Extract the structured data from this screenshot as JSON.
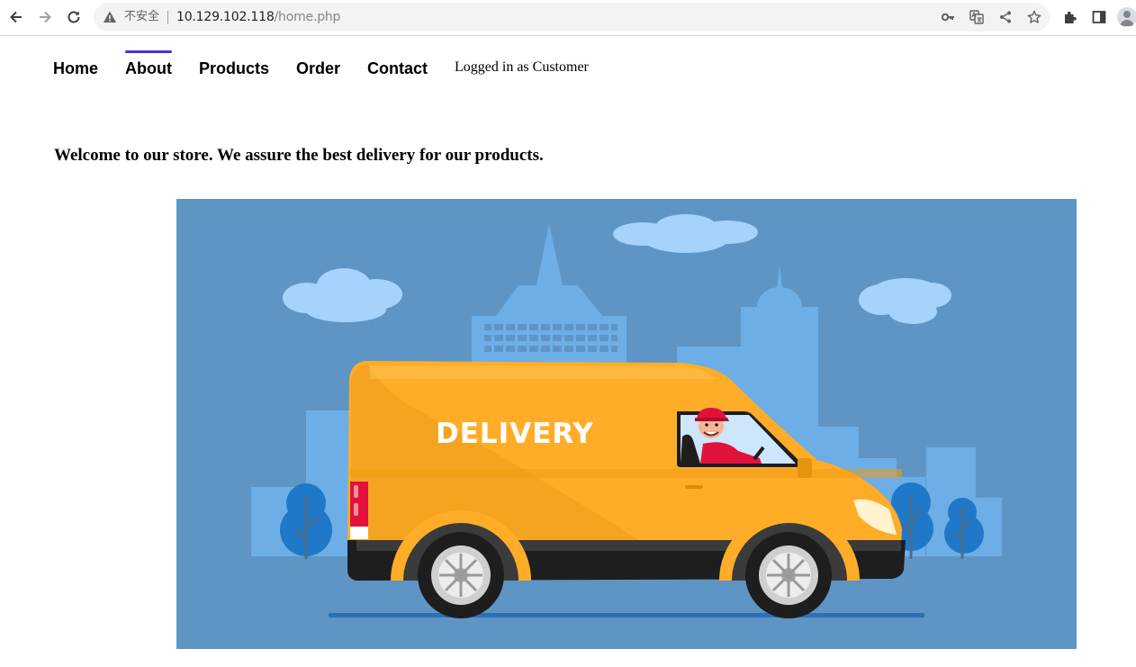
{
  "browser": {
    "security_label": "不安全",
    "url_host": "10.129.102.118",
    "url_path": "/home.php"
  },
  "nav": {
    "items": [
      {
        "label": "Home"
      },
      {
        "label": "About",
        "active": true
      },
      {
        "label": "Products"
      },
      {
        "label": "Order"
      },
      {
        "label": "Contact"
      }
    ],
    "active_color": "#4d2fd8"
  },
  "status": {
    "logged_in": "Logged in as Customer"
  },
  "main": {
    "welcome": "Welcome to our store. We assure the best delivery for our products.",
    "hero": {
      "van_text": "DELIVERY",
      "background": "#5f95c5",
      "van_color": "#ffad28"
    }
  }
}
